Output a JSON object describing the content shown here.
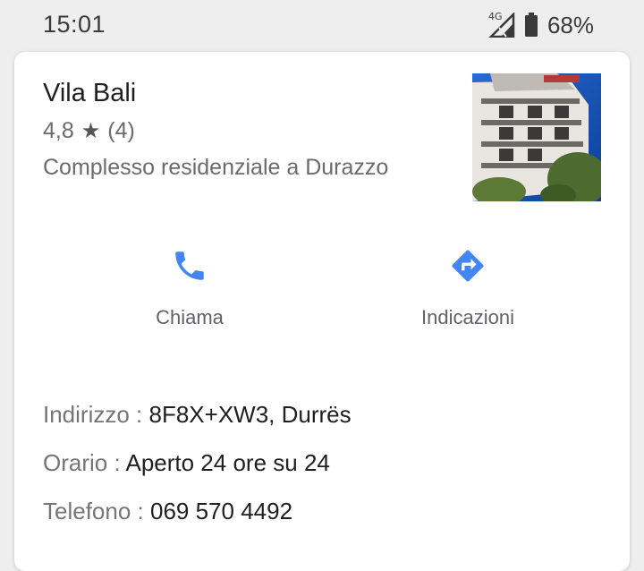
{
  "status_bar": {
    "time": "15:01",
    "network": "4G",
    "battery": "68%"
  },
  "place": {
    "name": "Vila Bali",
    "rating": "4,8",
    "reviews": "(4)",
    "category": "Complesso residenziale a Durazzo"
  },
  "actions": {
    "call_label": "Chiama",
    "directions_label": "Indicazioni"
  },
  "info": {
    "address_key": "Indirizzo : ",
    "address_value": "8F8X+XW3, Durrës",
    "hours_key": "Orario : ",
    "hours_value": "Aperto 24 ore su 24",
    "phone_key": "Telefono : ",
    "phone_value": "069 570 4492"
  },
  "colors": {
    "accent": "#4285f4",
    "text_primary": "#1f1f1f",
    "text_secondary": "#6b6b6b"
  }
}
